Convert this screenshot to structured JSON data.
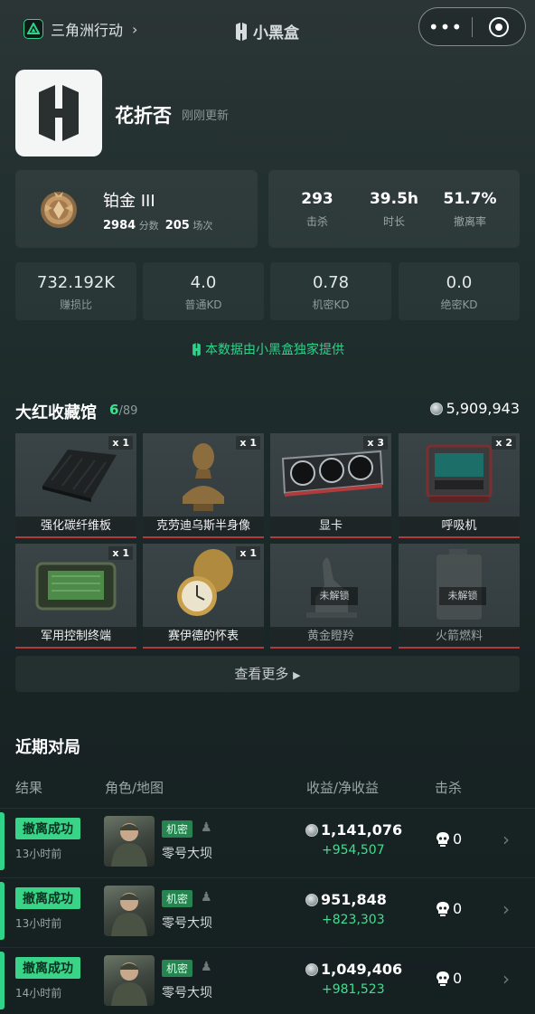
{
  "topbar": {
    "game_name": "三角洲行动",
    "brand": "小黑盒",
    "more_glyph": "•••"
  },
  "profile": {
    "username": "花折否",
    "update_status": "刚刚更新"
  },
  "rank": {
    "name": "铂金 III",
    "score": "2984",
    "score_unit": "分数",
    "matches": "205",
    "matches_unit": "场次"
  },
  "summary_stats": [
    {
      "value": "293",
      "label": "击杀"
    },
    {
      "value": "39.5h",
      "label": "时长"
    },
    {
      "value": "51.7%",
      "label": "撤离率"
    }
  ],
  "kd_stats": [
    {
      "value": "732.192K",
      "label": "赚损比"
    },
    {
      "value": "4.0",
      "label": "普通KD"
    },
    {
      "value": "0.78",
      "label": "机密KD"
    },
    {
      "value": "0.0",
      "label": "绝密KD"
    }
  ],
  "exclusive_note": "本数据由小黑盒独家提供",
  "collection": {
    "title": "大红收藏馆",
    "owned": "6",
    "total": "/89",
    "wealth": "5,909,943",
    "items": [
      {
        "name": "强化碳纤维板",
        "qty": "x 1",
        "icon": "carbon-plate-icon",
        "locked": false
      },
      {
        "name": "克劳迪乌斯半身像",
        "qty": "x 1",
        "icon": "bust-statue-icon",
        "locked": false
      },
      {
        "name": "显卡",
        "qty": "x 3",
        "icon": "graphics-card-icon",
        "locked": false
      },
      {
        "name": "呼吸机",
        "qty": "x 2",
        "icon": "ventilator-icon",
        "locked": false
      },
      {
        "name": "军用控制终端",
        "qty": "x 1",
        "icon": "control-terminal-icon",
        "locked": false
      },
      {
        "name": "赛伊德的怀表",
        "qty": "x 1",
        "icon": "pocket-watch-icon",
        "locked": false
      },
      {
        "name": "黄金瞪羚",
        "qty": "",
        "icon": "gazelle-statue-icon",
        "locked": true,
        "lock_text": "未解锁"
      },
      {
        "name": "火箭燃料",
        "qty": "",
        "icon": "fuel-canister-icon",
        "locked": true,
        "lock_text": "未解锁"
      }
    ],
    "see_more": "查看更多"
  },
  "recent": {
    "title": "近期对局",
    "headers": {
      "result": "结果",
      "role_map": "角色/地图",
      "income": "收益/净收益",
      "kills": "击杀"
    },
    "matches": [
      {
        "result": "撤离成功",
        "ago": "13小时前",
        "mode": "机密",
        "map": "零号大坝",
        "income": "1,141,076",
        "net": "+954,507",
        "kills": "0"
      },
      {
        "result": "撤离成功",
        "ago": "13小时前",
        "mode": "机密",
        "map": "零号大坝",
        "income": "951,848",
        "net": "+823,303",
        "kills": "0"
      },
      {
        "result": "撤离成功",
        "ago": "14小时前",
        "mode": "机密",
        "map": "零号大坝",
        "income": "1,049,406",
        "net": "+981,523",
        "kills": "0"
      }
    ]
  },
  "colors": {
    "accent_green": "#2fd48a",
    "result_badge": "#3ad489",
    "mode_badge": "#25844f",
    "item_rarity_red": "#b23a3a"
  }
}
